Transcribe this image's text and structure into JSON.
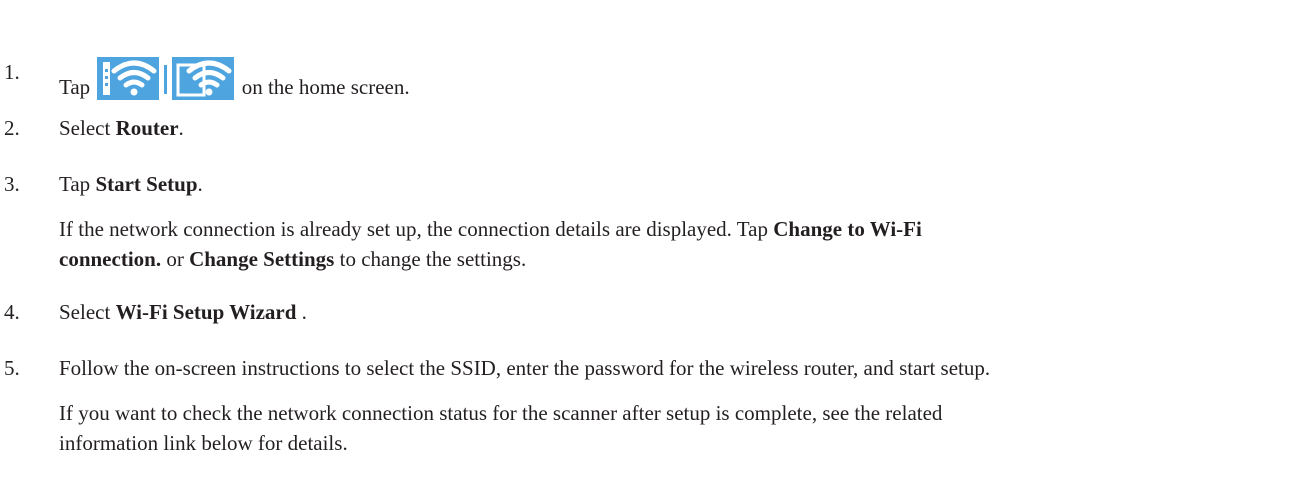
{
  "steps": [
    {
      "number": "1.",
      "before_icon": "Tap",
      "icon": "wifi-ethernet-status-icon",
      "after_icon": "on the home screen."
    },
    {
      "number": "2.",
      "prefix": "Select ",
      "bold": "Router",
      "suffix": "."
    },
    {
      "number": "3.",
      "prefix": "Tap ",
      "bold": "Start Setup",
      "suffix": ".",
      "note": {
        "line1_prefix": "If the network connection is already set up, the connection details are displayed. Tap ",
        "line1_bold": "Change to Wi-Fi",
        "line2_bold": "connection.",
        "line2_mid": " or ",
        "line2_bold2": "Change Settings",
        "line2_suffix": " to change the settings."
      }
    },
    {
      "number": "4.",
      "prefix": "Select ",
      "bold": "Wi-Fi Setup Wizard",
      "suffix": " ."
    },
    {
      "number": "5.",
      "text": "Follow the on-screen instructions to select the SSID, enter the password for the wireless router, and start setup.",
      "note": {
        "line1": "If you want to check the network connection status for the scanner after setup is complete, see the related",
        "line2": "information link below for details."
      }
    }
  ],
  "colors": {
    "text": "#231f20",
    "icon_blue": "#4ea4df"
  }
}
